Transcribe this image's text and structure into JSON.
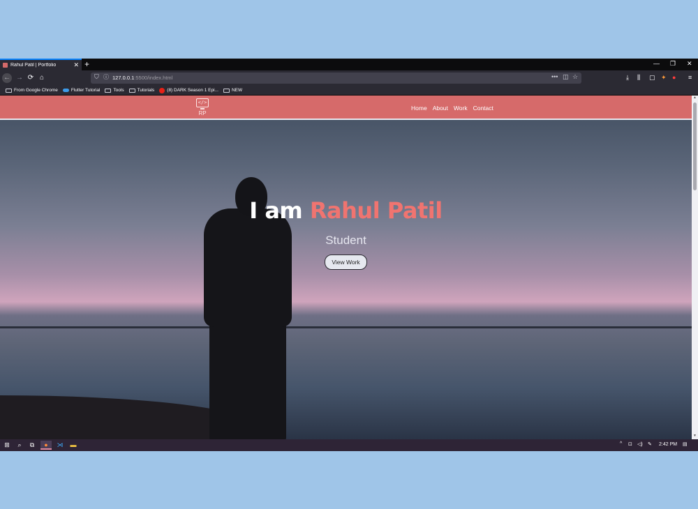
{
  "browser": {
    "tab_title": "Rahul Patil | Portfolio",
    "tab_close": "✕",
    "new_tab": "+",
    "url_host": "127.0.0.1",
    "url_rest": ":5500/index.html",
    "window_controls": {
      "minimize": "—",
      "maximize": "❐",
      "close": "✕"
    },
    "nav_icons": {
      "back": "←",
      "forward": "→",
      "reload": "⟳",
      "home": "⌂"
    },
    "bookmarks": [
      {
        "label": "From Google Chrome",
        "icon": "folder-icon"
      },
      {
        "label": "Flutter Tutorial",
        "icon": "cloud-icon"
      },
      {
        "label": "Tools",
        "icon": "folder-icon"
      },
      {
        "label": "Tutorials",
        "icon": "folder-icon"
      },
      {
        "label": "(8) DARK Season 1 Epi...",
        "icon": "youtube-icon"
      },
      {
        "label": "NEW",
        "icon": "folder-icon"
      }
    ]
  },
  "site": {
    "logo_symbol": "</>",
    "logo_text": "RP",
    "nav": [
      "Home",
      "About",
      "Work",
      "Contact"
    ],
    "hero": {
      "title_prefix": "I am ",
      "title_name": "Rahul Patil",
      "subtitle": "Student",
      "button": "View Work"
    },
    "colors": {
      "accent": "#d66a6a",
      "name": "#f07470"
    }
  },
  "taskbar": {
    "clock": "2:42 PM",
    "apps": [
      "windows-start-icon",
      "search-icon",
      "task-view-icon",
      "firefox-icon",
      "vscode-icon",
      "file-explorer-icon"
    ]
  }
}
